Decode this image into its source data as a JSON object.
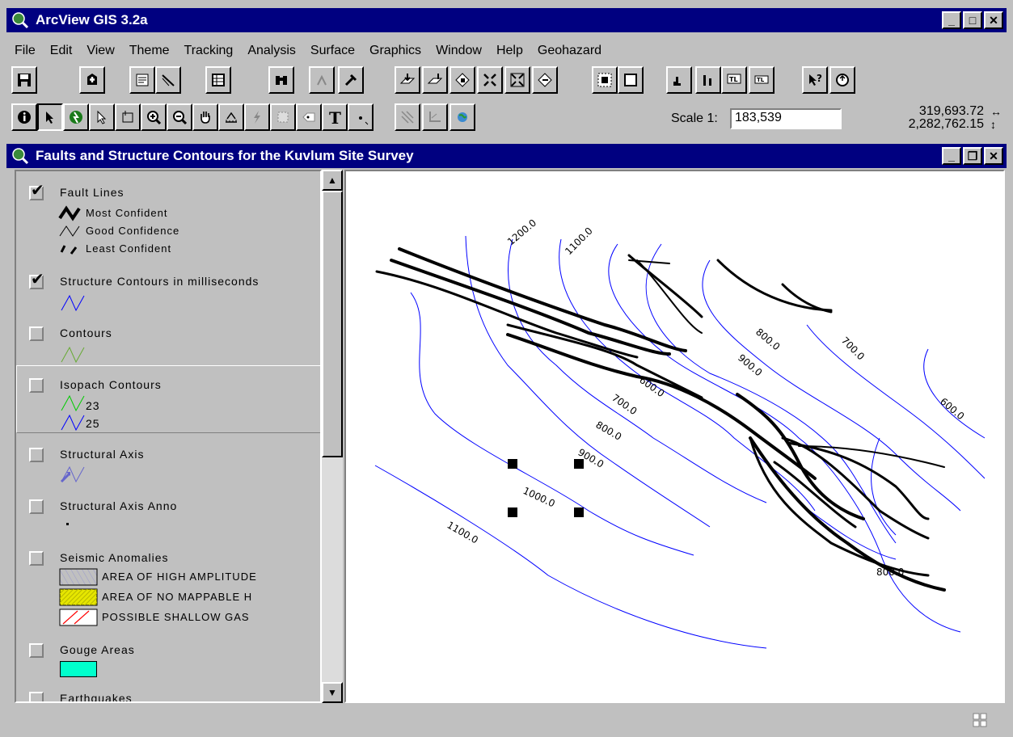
{
  "app": {
    "title": "ArcView GIS 3.2a",
    "window_buttons": [
      "_",
      "□",
      "✕"
    ]
  },
  "menu": [
    "File",
    "Edit",
    "View",
    "Theme",
    "Tracking",
    "Analysis",
    "Surface",
    "Graphics",
    "Window",
    "Help",
    "Geohazard"
  ],
  "scale": {
    "label": "Scale 1:",
    "value": "183,539"
  },
  "coords": {
    "x": "319,693.72",
    "y": "2,282,762.15"
  },
  "view": {
    "title": "Faults and Structure Contours for the Kuvlum Site Survey",
    "window_buttons": [
      "_",
      "❐",
      "✕"
    ]
  },
  "toc": {
    "themes": [
      {
        "name": "Fault Lines",
        "checked": true,
        "legend": [
          "Most Confident",
          "Good Confidence",
          "Least Confident"
        ]
      },
      {
        "name": "Structure Contours in milliseconds",
        "checked": true,
        "legend": []
      },
      {
        "name": "Contours",
        "checked": false,
        "legend": []
      },
      {
        "name": "Isopach Contours",
        "checked": false,
        "legend": [
          "23",
          "25"
        ]
      },
      {
        "name": "Structural Axis",
        "checked": false,
        "legend": []
      },
      {
        "name": "Structural Axis Anno",
        "checked": false,
        "legend": []
      },
      {
        "name": "Seismic Anomalies",
        "checked": false,
        "legend": [
          "AREA OF HIGH AMPLITUDE",
          "AREA OF NO MAPPABLE H",
          "POSSIBLE SHALLOW GAS"
        ]
      },
      {
        "name": "Gouge Areas",
        "checked": false,
        "legend": []
      },
      {
        "name": "Earthquakes",
        "checked": false,
        "legend": []
      }
    ]
  },
  "map_labels": [
    "1200.0",
    "1100.0",
    "800.0",
    "900.0",
    "700.0",
    "600.0",
    "700.0",
    "800.0",
    "900.0",
    "1000.0",
    "1100.0",
    "600.0",
    "800.0"
  ],
  "colors": {
    "titlebar": "#000080",
    "contour": "#0000ff",
    "fault": "#000000",
    "gouge": "#00ffcc",
    "no_mappable": "#e6e600",
    "shallow_gas": "#ff0000"
  }
}
